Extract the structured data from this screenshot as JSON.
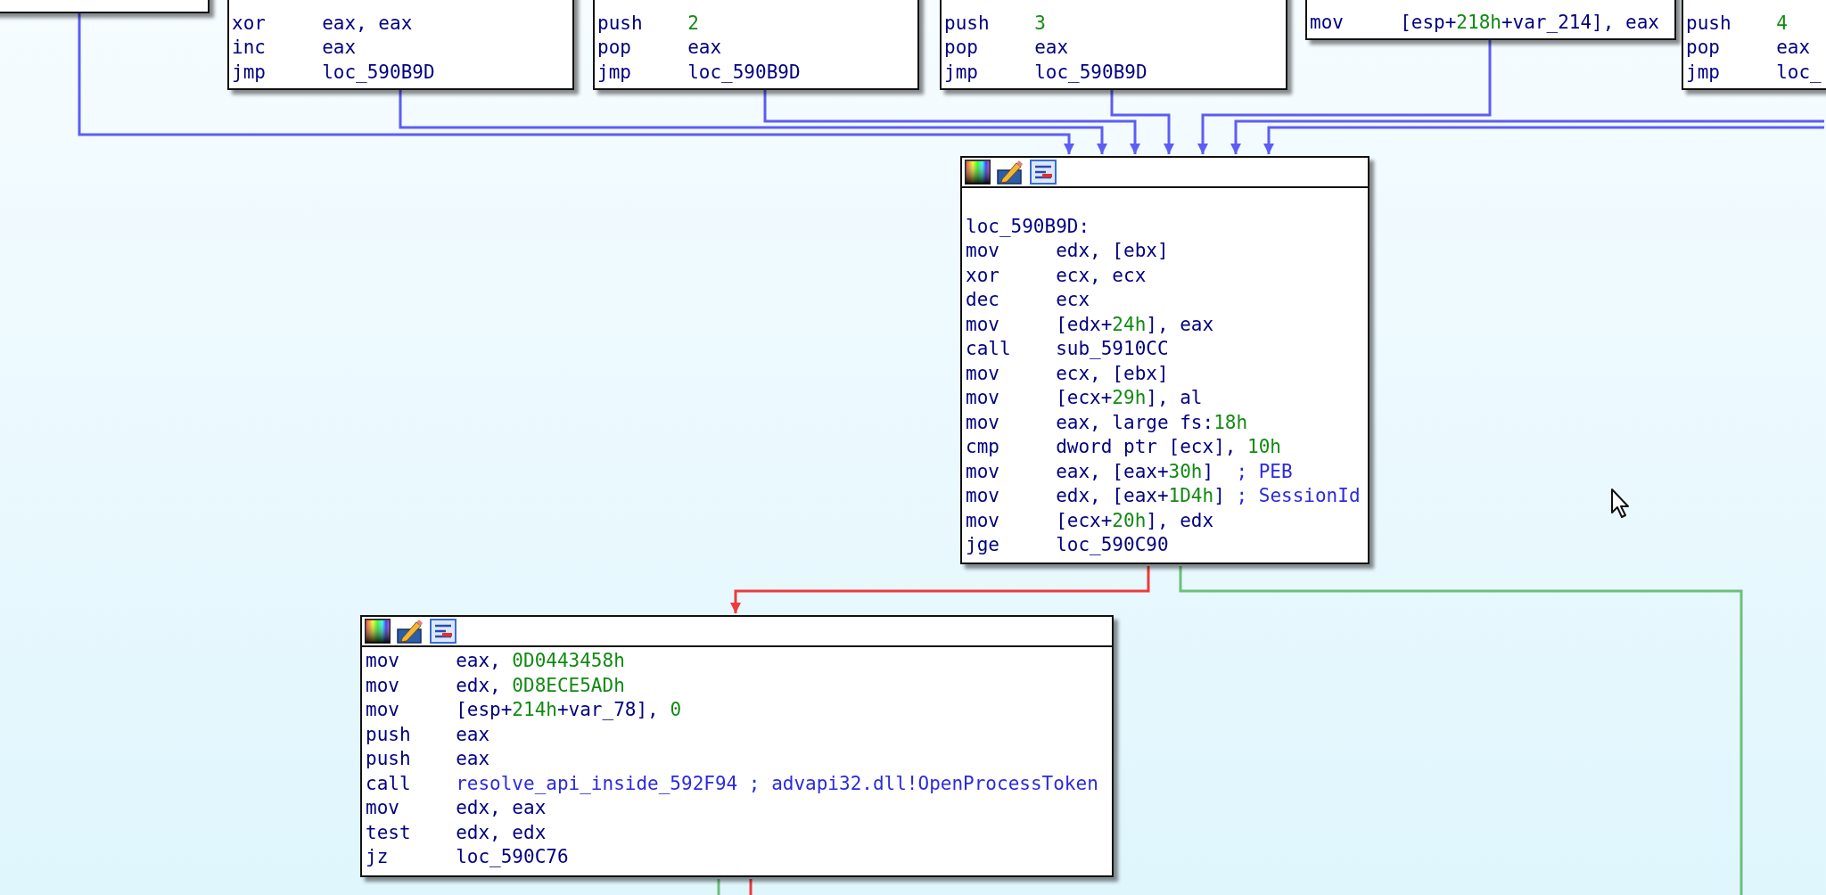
{
  "nodes": [
    {
      "lines": [
        {
          "mnemonic": "xor",
          "operand": [
            {
              "text": "eax, eax",
              "kind": "plain"
            }
          ]
        },
        {
          "mnemonic": "inc",
          "operand": [
            {
              "text": "eax",
              "kind": "plain"
            }
          ]
        },
        {
          "mnemonic": "jmp",
          "operand": [
            {
              "text": "loc_590B9D",
              "kind": "plain"
            }
          ]
        }
      ]
    },
    {
      "lines": [
        {
          "mnemonic": "push",
          "operand": [
            {
              "text": "2",
              "kind": "number"
            }
          ]
        },
        {
          "mnemonic": "pop",
          "operand": [
            {
              "text": "eax",
              "kind": "plain"
            }
          ]
        },
        {
          "mnemonic": "jmp",
          "operand": [
            {
              "text": "loc_590B9D",
              "kind": "plain"
            }
          ]
        }
      ]
    },
    {
      "lines": [
        {
          "mnemonic": "push",
          "operand": [
            {
              "text": "3",
              "kind": "number"
            }
          ]
        },
        {
          "mnemonic": "pop",
          "operand": [
            {
              "text": "eax",
              "kind": "plain"
            }
          ]
        },
        {
          "mnemonic": "jmp",
          "operand": [
            {
              "text": "loc_590B9D",
              "kind": "plain"
            }
          ]
        }
      ]
    },
    {
      "lines": [
        {
          "mnemonic": "mov",
          "operand": [
            {
              "text": "[esp+",
              "kind": "plain"
            },
            {
              "text": "218h",
              "kind": "number"
            },
            {
              "text": "+var_214], eax",
              "kind": "plain"
            }
          ]
        }
      ]
    },
    {
      "lines": [
        {
          "mnemonic": "push",
          "operand": [
            {
              "text": "4",
              "kind": "number"
            }
          ]
        },
        {
          "mnemonic": "pop",
          "operand": [
            {
              "text": "eax",
              "kind": "plain"
            }
          ]
        },
        {
          "mnemonic": "jmp",
          "operand": [
            {
              "text": "loc_",
              "kind": "plain"
            }
          ]
        }
      ]
    },
    {
      "header": true,
      "lines": [
        {
          "label": "loc_590B9D:"
        },
        {
          "mnemonic": "mov",
          "operand": [
            {
              "text": "edx, [ebx]",
              "kind": "plain"
            }
          ]
        },
        {
          "mnemonic": "xor",
          "operand": [
            {
              "text": "ecx, ecx",
              "kind": "plain"
            }
          ]
        },
        {
          "mnemonic": "dec",
          "operand": [
            {
              "text": "ecx",
              "kind": "plain"
            }
          ]
        },
        {
          "mnemonic": "mov",
          "operand": [
            {
              "text": "[edx+",
              "kind": "plain"
            },
            {
              "text": "24h",
              "kind": "number"
            },
            {
              "text": "], eax",
              "kind": "plain"
            }
          ]
        },
        {
          "mnemonic": "call",
          "operand": [
            {
              "text": "sub_5910CC",
              "kind": "plain"
            }
          ]
        },
        {
          "mnemonic": "mov",
          "operand": [
            {
              "text": "ecx, [ebx]",
              "kind": "plain"
            }
          ]
        },
        {
          "mnemonic": "mov",
          "operand": [
            {
              "text": "[ecx+",
              "kind": "plain"
            },
            {
              "text": "29h",
              "kind": "number"
            },
            {
              "text": "], al",
              "kind": "plain"
            }
          ]
        },
        {
          "mnemonic": "mov",
          "operand": [
            {
              "text": "eax, large fs:",
              "kind": "plain"
            },
            {
              "text": "18h",
              "kind": "number"
            }
          ]
        },
        {
          "mnemonic": "cmp",
          "operand": [
            {
              "text": "dword ptr [ecx], ",
              "kind": "plain"
            },
            {
              "text": "10h",
              "kind": "number"
            }
          ]
        },
        {
          "mnemonic": "mov",
          "operand": [
            {
              "text": "eax, [eax+",
              "kind": "plain"
            },
            {
              "text": "30h",
              "kind": "number"
            },
            {
              "text": "]",
              "kind": "plain"
            }
          ],
          "comment": "; PEB"
        },
        {
          "mnemonic": "mov",
          "operand": [
            {
              "text": "edx, [eax+",
              "kind": "plain"
            },
            {
              "text": "1D4h",
              "kind": "number"
            },
            {
              "text": "]",
              "kind": "plain"
            }
          ],
          "comment": "; SessionId"
        },
        {
          "mnemonic": "mov",
          "operand": [
            {
              "text": "[ecx+",
              "kind": "plain"
            },
            {
              "text": "20h",
              "kind": "number"
            },
            {
              "text": "], edx",
              "kind": "plain"
            }
          ]
        },
        {
          "mnemonic": "jge",
          "operand": [
            {
              "text": "loc_590C90",
              "kind": "plain"
            }
          ]
        }
      ]
    },
    {
      "header": true,
      "lines": [
        {
          "mnemonic": "mov",
          "operand": [
            {
              "text": "eax, ",
              "kind": "plain"
            },
            {
              "text": "0D0443458h",
              "kind": "number"
            }
          ]
        },
        {
          "mnemonic": "mov",
          "operand": [
            {
              "text": "edx, ",
              "kind": "plain"
            },
            {
              "text": "0D8ECE5ADh",
              "kind": "number"
            }
          ]
        },
        {
          "mnemonic": "mov",
          "operand": [
            {
              "text": "[esp+",
              "kind": "plain"
            },
            {
              "text": "214h",
              "kind": "number"
            },
            {
              "text": "+var_78], ",
              "kind": "plain"
            },
            {
              "text": "0",
              "kind": "number"
            }
          ]
        },
        {
          "mnemonic": "push",
          "operand": [
            {
              "text": "eax",
              "kind": "plain"
            }
          ]
        },
        {
          "mnemonic": "push",
          "operand": [
            {
              "text": "eax",
              "kind": "plain"
            }
          ]
        },
        {
          "mnemonic": "call",
          "operand": [
            {
              "text": "resolve_api_inside_592F94",
              "kind": "name"
            }
          ],
          "comment": "; advapi32.dll!OpenProcessToken"
        },
        {
          "mnemonic": "mov",
          "operand": [
            {
              "text": "edx, eax",
              "kind": "plain"
            }
          ]
        },
        {
          "mnemonic": "test",
          "operand": [
            {
              "text": "edx, edx",
              "kind": "plain"
            }
          ]
        },
        {
          "mnemonic": "jz",
          "operand": [
            {
              "text": "loc_590C76",
              "kind": "plain"
            }
          ]
        }
      ]
    }
  ]
}
